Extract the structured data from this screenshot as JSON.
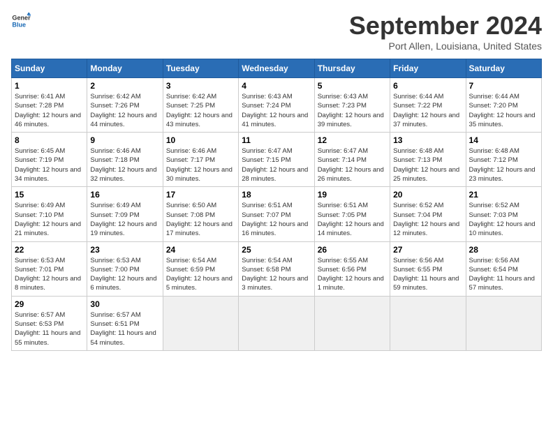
{
  "header": {
    "logo_line1": "General",
    "logo_line2": "Blue",
    "month_title": "September 2024",
    "location": "Port Allen, Louisiana, United States"
  },
  "days_of_week": [
    "Sunday",
    "Monday",
    "Tuesday",
    "Wednesday",
    "Thursday",
    "Friday",
    "Saturday"
  ],
  "weeks": [
    [
      {
        "day": 1,
        "sunrise": "6:41 AM",
        "sunset": "7:28 PM",
        "daylight": "12 hours and 46 minutes."
      },
      {
        "day": 2,
        "sunrise": "6:42 AM",
        "sunset": "7:26 PM",
        "daylight": "12 hours and 44 minutes."
      },
      {
        "day": 3,
        "sunrise": "6:42 AM",
        "sunset": "7:25 PM",
        "daylight": "12 hours and 43 minutes."
      },
      {
        "day": 4,
        "sunrise": "6:43 AM",
        "sunset": "7:24 PM",
        "daylight": "12 hours and 41 minutes."
      },
      {
        "day": 5,
        "sunrise": "6:43 AM",
        "sunset": "7:23 PM",
        "daylight": "12 hours and 39 minutes."
      },
      {
        "day": 6,
        "sunrise": "6:44 AM",
        "sunset": "7:22 PM",
        "daylight": "12 hours and 37 minutes."
      },
      {
        "day": 7,
        "sunrise": "6:44 AM",
        "sunset": "7:20 PM",
        "daylight": "12 hours and 35 minutes."
      }
    ],
    [
      {
        "day": 8,
        "sunrise": "6:45 AM",
        "sunset": "7:19 PM",
        "daylight": "12 hours and 34 minutes."
      },
      {
        "day": 9,
        "sunrise": "6:46 AM",
        "sunset": "7:18 PM",
        "daylight": "12 hours and 32 minutes."
      },
      {
        "day": 10,
        "sunrise": "6:46 AM",
        "sunset": "7:17 PM",
        "daylight": "12 hours and 30 minutes."
      },
      {
        "day": 11,
        "sunrise": "6:47 AM",
        "sunset": "7:15 PM",
        "daylight": "12 hours and 28 minutes."
      },
      {
        "day": 12,
        "sunrise": "6:47 AM",
        "sunset": "7:14 PM",
        "daylight": "12 hours and 26 minutes."
      },
      {
        "day": 13,
        "sunrise": "6:48 AM",
        "sunset": "7:13 PM",
        "daylight": "12 hours and 25 minutes."
      },
      {
        "day": 14,
        "sunrise": "6:48 AM",
        "sunset": "7:12 PM",
        "daylight": "12 hours and 23 minutes."
      }
    ],
    [
      {
        "day": 15,
        "sunrise": "6:49 AM",
        "sunset": "7:10 PM",
        "daylight": "12 hours and 21 minutes."
      },
      {
        "day": 16,
        "sunrise": "6:49 AM",
        "sunset": "7:09 PM",
        "daylight": "12 hours and 19 minutes."
      },
      {
        "day": 17,
        "sunrise": "6:50 AM",
        "sunset": "7:08 PM",
        "daylight": "12 hours and 17 minutes."
      },
      {
        "day": 18,
        "sunrise": "6:51 AM",
        "sunset": "7:07 PM",
        "daylight": "12 hours and 16 minutes."
      },
      {
        "day": 19,
        "sunrise": "6:51 AM",
        "sunset": "7:05 PM",
        "daylight": "12 hours and 14 minutes."
      },
      {
        "day": 20,
        "sunrise": "6:52 AM",
        "sunset": "7:04 PM",
        "daylight": "12 hours and 12 minutes."
      },
      {
        "day": 21,
        "sunrise": "6:52 AM",
        "sunset": "7:03 PM",
        "daylight": "12 hours and 10 minutes."
      }
    ],
    [
      {
        "day": 22,
        "sunrise": "6:53 AM",
        "sunset": "7:01 PM",
        "daylight": "12 hours and 8 minutes."
      },
      {
        "day": 23,
        "sunrise": "6:53 AM",
        "sunset": "7:00 PM",
        "daylight": "12 hours and 6 minutes."
      },
      {
        "day": 24,
        "sunrise": "6:54 AM",
        "sunset": "6:59 PM",
        "daylight": "12 hours and 5 minutes."
      },
      {
        "day": 25,
        "sunrise": "6:54 AM",
        "sunset": "6:58 PM",
        "daylight": "12 hours and 3 minutes."
      },
      {
        "day": 26,
        "sunrise": "6:55 AM",
        "sunset": "6:56 PM",
        "daylight": "12 hours and 1 minute."
      },
      {
        "day": 27,
        "sunrise": "6:56 AM",
        "sunset": "6:55 PM",
        "daylight": "11 hours and 59 minutes."
      },
      {
        "day": 28,
        "sunrise": "6:56 AM",
        "sunset": "6:54 PM",
        "daylight": "11 hours and 57 minutes."
      }
    ],
    [
      {
        "day": 29,
        "sunrise": "6:57 AM",
        "sunset": "6:53 PM",
        "daylight": "11 hours and 55 minutes."
      },
      {
        "day": 30,
        "sunrise": "6:57 AM",
        "sunset": "6:51 PM",
        "daylight": "11 hours and 54 minutes."
      },
      null,
      null,
      null,
      null,
      null
    ]
  ]
}
